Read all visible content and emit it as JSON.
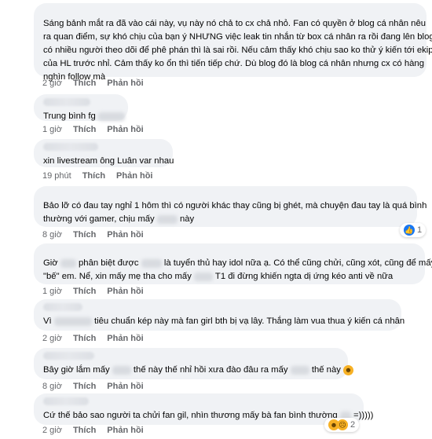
{
  "comments": [
    {
      "lines": [
        "Sáng bảnh mắt ra đã vào cái này, vụ này nó chả to cx chả nhỏ. Fan có quyền ở blog cá nhân nêu",
        "ra quan điểm, sự khó chịu của bạn ý NHƯNG việc leak tin nhắn từ box cá nhân ra rồi đang lên blog",
        "có nhiều người theo dõi để phê phán thì là sai rồi. Nếu cảm thấy khó chịu sao ko thử ý kiến tới ekip",
        "của HL trước nhỉ. Cảm thấy ko ổn thì tiến tiếp chứ. Dù blog đó là blog cá nhân nhưng cx có hàng",
        "nghìn follow mà"
      ],
      "time": "2 giờ"
    },
    {
      "before": "Trung bình fg",
      "after": "",
      "time": "1 giờ"
    },
    {
      "text": "xin livestream ông Luân var nhau",
      "time": "19 phút"
    },
    {
      "lines": [
        "Bảo lỡ có đau tay nghỉ 1 hôm thì có người khác thay cũng bị ghét, mà chuyện đau tay là quá bình"
      ],
      "line2_before": "thường với gamer, chịu mấy",
      "line2_after": "này",
      "time": "8 giờ",
      "reaction_count": "1"
    },
    {
      "line1_a": "Giờ",
      "line1_b": "phân biệt được",
      "line1_c": "là tuyển thủ hay idol nữa ạ. Có thể cũng chửi, cũng xót, cũng để mấy chị",
      "line2_a": "\"bế\" em. Nể, xin mấy mẹ tha cho mấy",
      "line2_b": "T1 đi đừng khiến ngta dị ứng kéo anti về nữa",
      "time": "1 giờ"
    },
    {
      "before": "Vì",
      "after": "tiêu chuẩn kép này mà fan girl bth bị vạ lây. Thắng làm vua thua ý kiến cá nhân",
      "time": "2 giờ"
    },
    {
      "a": "Bây giờ lắm mấy",
      "b": "thế này thế nhỉ hồi xưa đào đâu ra mấy",
      "c": "thế này",
      "time": "8 giờ"
    },
    {
      "before": "Cứ thế bảo sao người ta chửi fan gil, nhìn thương mấy bà fan bình thường",
      "after": "=)))))",
      "time": "2 giờ",
      "reaction_count": "2"
    }
  ],
  "labels": {
    "like": "Thích",
    "reply": "Phản hồi"
  },
  "icons": {
    "like": "like-icon",
    "haha": "haha-emoji",
    "sad": "sad-emoji"
  },
  "colors": {
    "bubble": "#f0f2f5",
    "meta": "#65676b",
    "like": "#1877f2"
  }
}
